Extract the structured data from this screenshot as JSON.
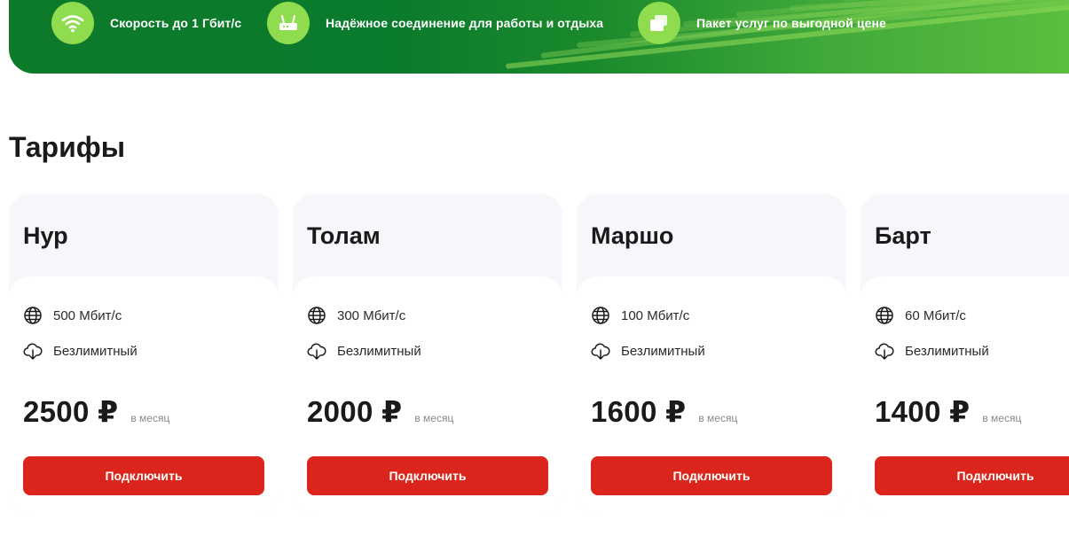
{
  "banner": {
    "features": [
      {
        "icon": "wifi-icon",
        "text": "Скорость до 1 Гбит/с"
      },
      {
        "icon": "router-icon",
        "text": "Надёжное соединение для работы и отдыха"
      },
      {
        "icon": "package-icon",
        "text": "Пакет услуг по выгодной цене"
      }
    ],
    "colors": {
      "dark_green": "#0a7a2c",
      "light_green": "#5cbf3f",
      "icon_bg": "#8fdc4e"
    }
  },
  "tariffs_section": {
    "title": "Тарифы",
    "cards": [
      {
        "name": "Нур",
        "speed": "500 Мбит/с",
        "traffic": "Безлимитный",
        "price": "2500 ₽",
        "period": "в месяц",
        "button": "Подключить"
      },
      {
        "name": "Толам",
        "speed": "300 Мбит/с",
        "traffic": "Безлимитный",
        "price": "2000 ₽",
        "period": "в месяц",
        "button": "Подключить"
      },
      {
        "name": "Маршо",
        "speed": "100 Мбит/с",
        "traffic": "Безлимитный",
        "price": "1600 ₽",
        "period": "в месяц",
        "button": "Подключить"
      },
      {
        "name": "Барт",
        "speed": "60 Мбит/с",
        "traffic": "Безлимитный",
        "price": "1400 ₽",
        "period": "в месяц",
        "button": "Подключить"
      }
    ]
  },
  "icons": {
    "speed": "globe-icon",
    "traffic": "cloud-download-icon"
  },
  "colors": {
    "accent_red": "#db241b",
    "card_header_bg": "#f6f7fb",
    "text": "#1a1a1a"
  }
}
